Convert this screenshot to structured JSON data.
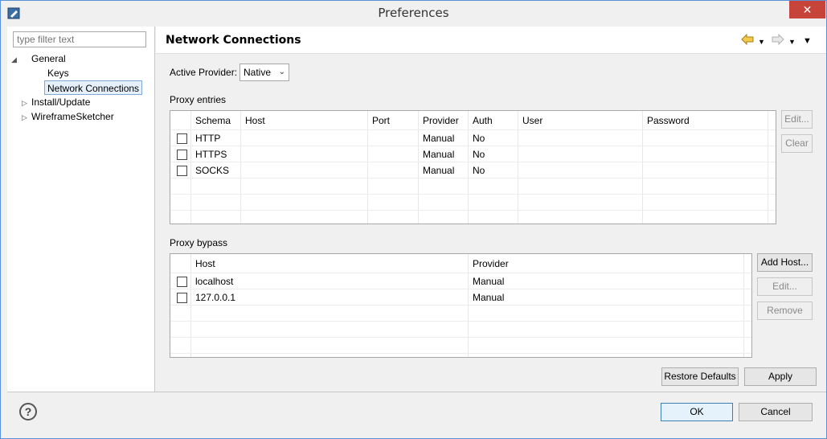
{
  "window": {
    "title": "Preferences",
    "close_glyph": "✕"
  },
  "filter": {
    "placeholder": "type filter text"
  },
  "tree": {
    "general": "General",
    "keys": "Keys",
    "network_connections": "Network Connections",
    "install_update": "Install/Update",
    "wireframesketcher": "WireframeSketcher"
  },
  "page": {
    "title": "Network Connections"
  },
  "provider": {
    "label": "Active Provider:",
    "value": "Native"
  },
  "proxy_entries": {
    "label": "Proxy entries",
    "columns": [
      "Schema",
      "Host",
      "Port",
      "Provider",
      "Auth",
      "User",
      "Password"
    ],
    "rows": [
      {
        "schema": "HTTP",
        "host": "",
        "port": "",
        "provider": "Manual",
        "auth": "No",
        "user": "",
        "password": ""
      },
      {
        "schema": "HTTPS",
        "host": "",
        "port": "",
        "provider": "Manual",
        "auth": "No",
        "user": "",
        "password": ""
      },
      {
        "schema": "SOCKS",
        "host": "",
        "port": "",
        "provider": "Manual",
        "auth": "No",
        "user": "",
        "password": ""
      }
    ],
    "edit_label": "Edit...",
    "clear_label": "Clear"
  },
  "proxy_bypass": {
    "label": "Proxy bypass",
    "columns": [
      "Host",
      "Provider"
    ],
    "rows": [
      {
        "host": "localhost",
        "provider": "Manual"
      },
      {
        "host": "127.0.0.1",
        "provider": "Manual"
      }
    ],
    "add_host_label": "Add Host...",
    "edit_label": "Edit...",
    "remove_label": "Remove"
  },
  "buttons": {
    "restore_defaults": "Restore Defaults",
    "apply": "Apply",
    "ok": "OK",
    "cancel": "Cancel"
  },
  "icons": {
    "app": "eclipse-preferences-icon",
    "help": "help-icon",
    "back": "back-arrow-icon",
    "forward": "forward-arrow-icon",
    "menu": "view-menu-icon"
  },
  "colors": {
    "close_button": "#c7443a",
    "selection": "#e5f0fb",
    "accent": "#3c7fb1"
  }
}
